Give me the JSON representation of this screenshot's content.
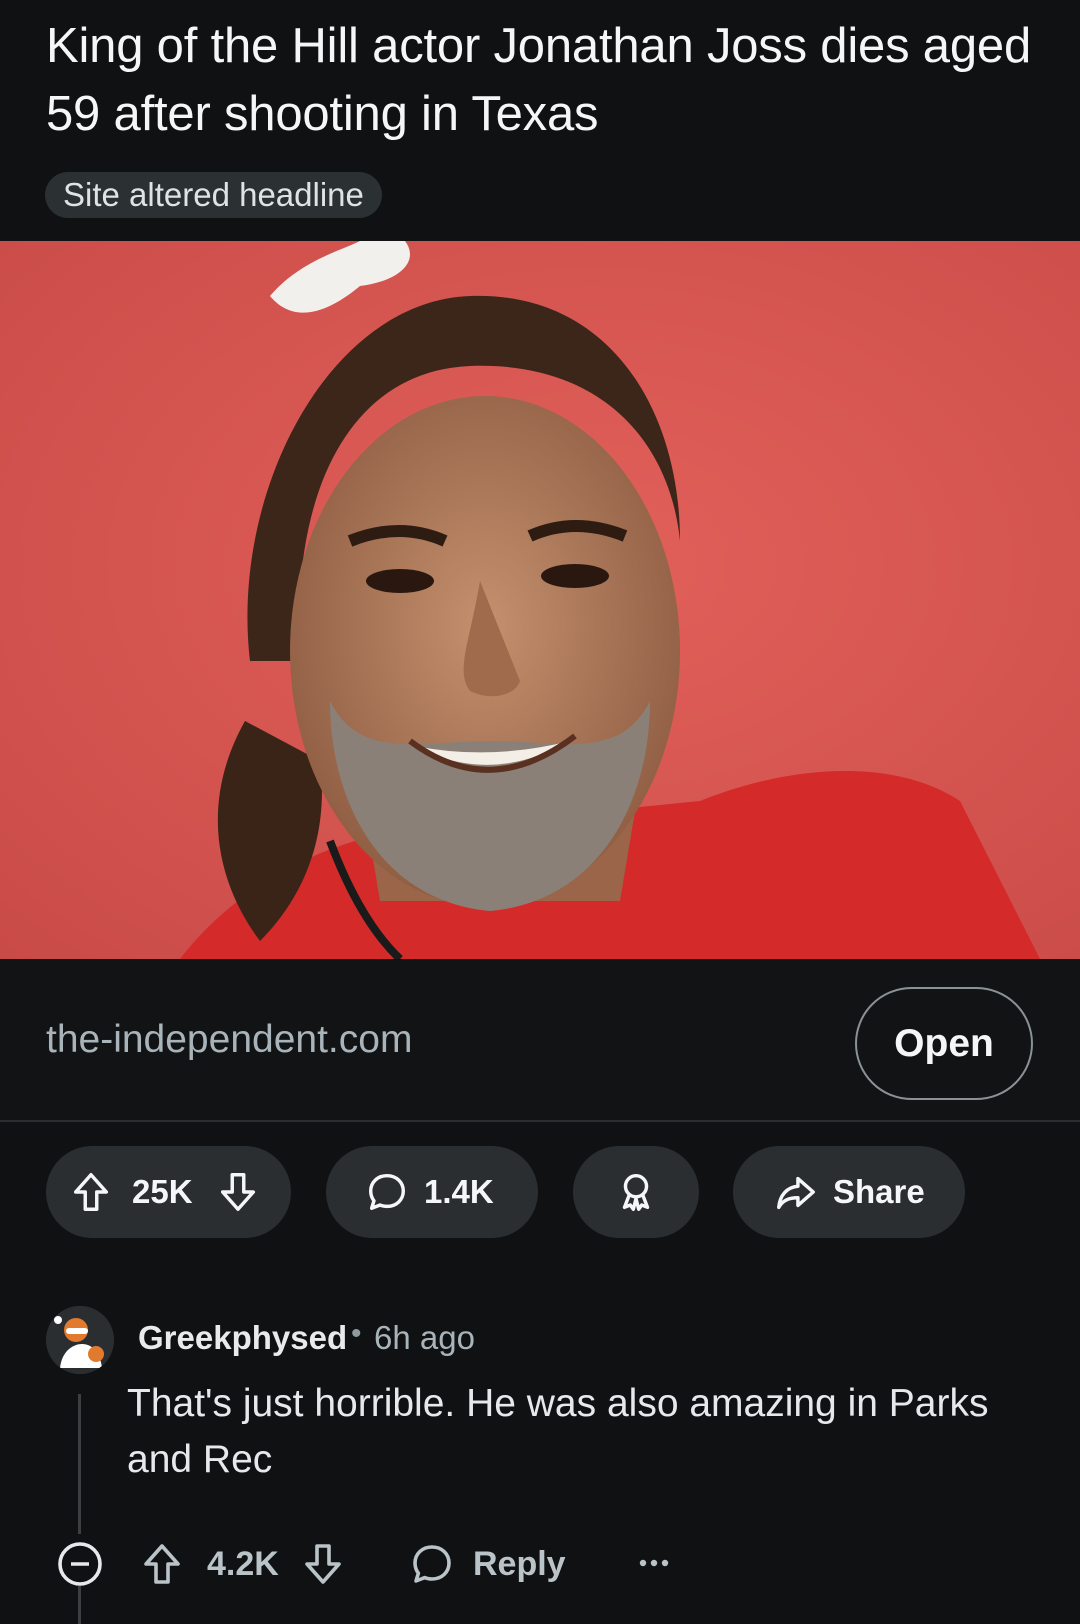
{
  "post": {
    "title": "King of the Hill actor Jonathan Joss dies aged 59 after shooting in Texas",
    "flair": "Site altered headline",
    "thumbnail_alt": "",
    "link_domain": "the-independent.com",
    "open_label": "Open"
  },
  "actions": {
    "score": "25K",
    "comments": "1.4K",
    "share_label": "Share"
  },
  "comment": {
    "author": "Greekphysed",
    "separator": "•",
    "time": "6h ago",
    "body": "That's just horrible. He was also amazing in Parks and Rec",
    "score": "4.2K",
    "reply_label": "Reply"
  },
  "icons": [
    "upvote-icon",
    "downvote-icon",
    "comment-icon",
    "award-icon",
    "share-icon",
    "collapse-icon",
    "reply-icon",
    "more-icon"
  ],
  "colors": {
    "background": "#0f1113",
    "pill": "#2a2e31",
    "text": "#f4f6f7",
    "muted": "#a8b3ba",
    "photo_background": "#d4544f",
    "shirt": "#d42a2a"
  }
}
